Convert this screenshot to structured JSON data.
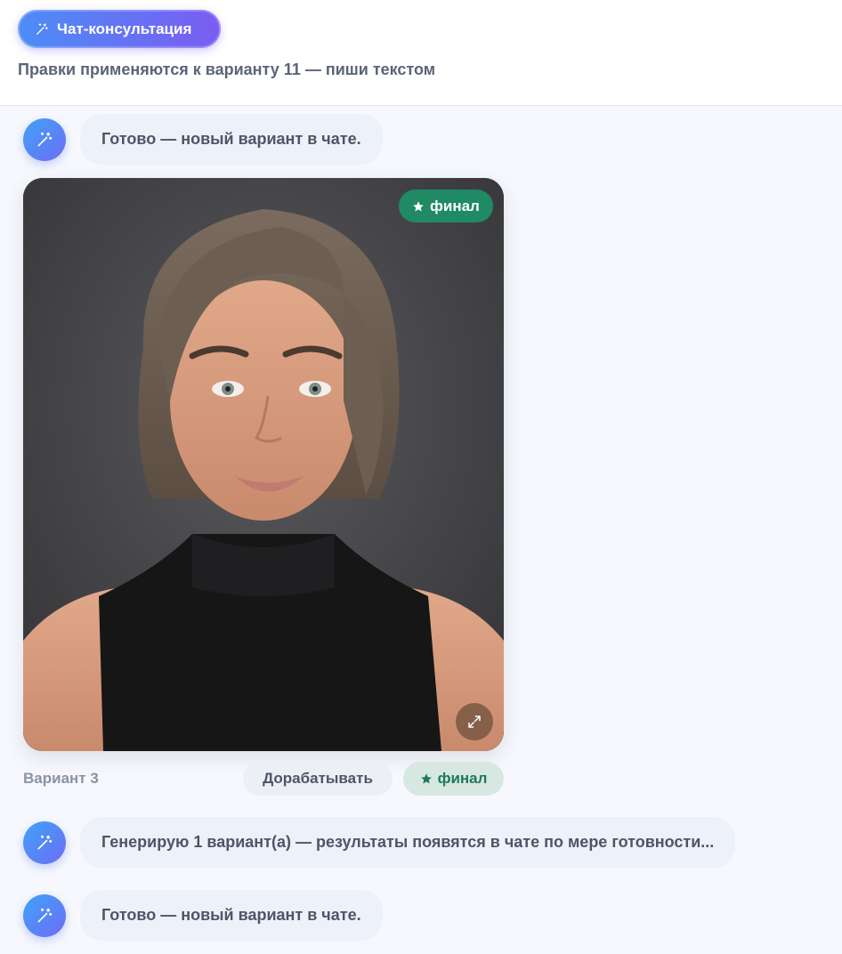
{
  "header": {
    "chat_button_label": "Чат-консультация",
    "subtitle": "Правки применяются к варианту 11 — пиши текстом"
  },
  "messages": [
    {
      "text": "Готово — новый вариант в чате."
    },
    {
      "text": "Генерирую 1 вариант(а) — результаты появятся в чате по мере готовности..."
    },
    {
      "text": "Готово — новый вариант в чате."
    }
  ],
  "variant_card": {
    "badge_label": "финал",
    "label": "Вариант 3",
    "refine_button": "Дорабатывать",
    "final_button": "финал",
    "expand_icon": "expand-icon"
  },
  "colors": {
    "accent_gradient_start": "#4c8df6",
    "accent_gradient_end": "#7b5cf2",
    "final_green": "#1f8a64",
    "bubble_bg": "#edf1f9"
  }
}
